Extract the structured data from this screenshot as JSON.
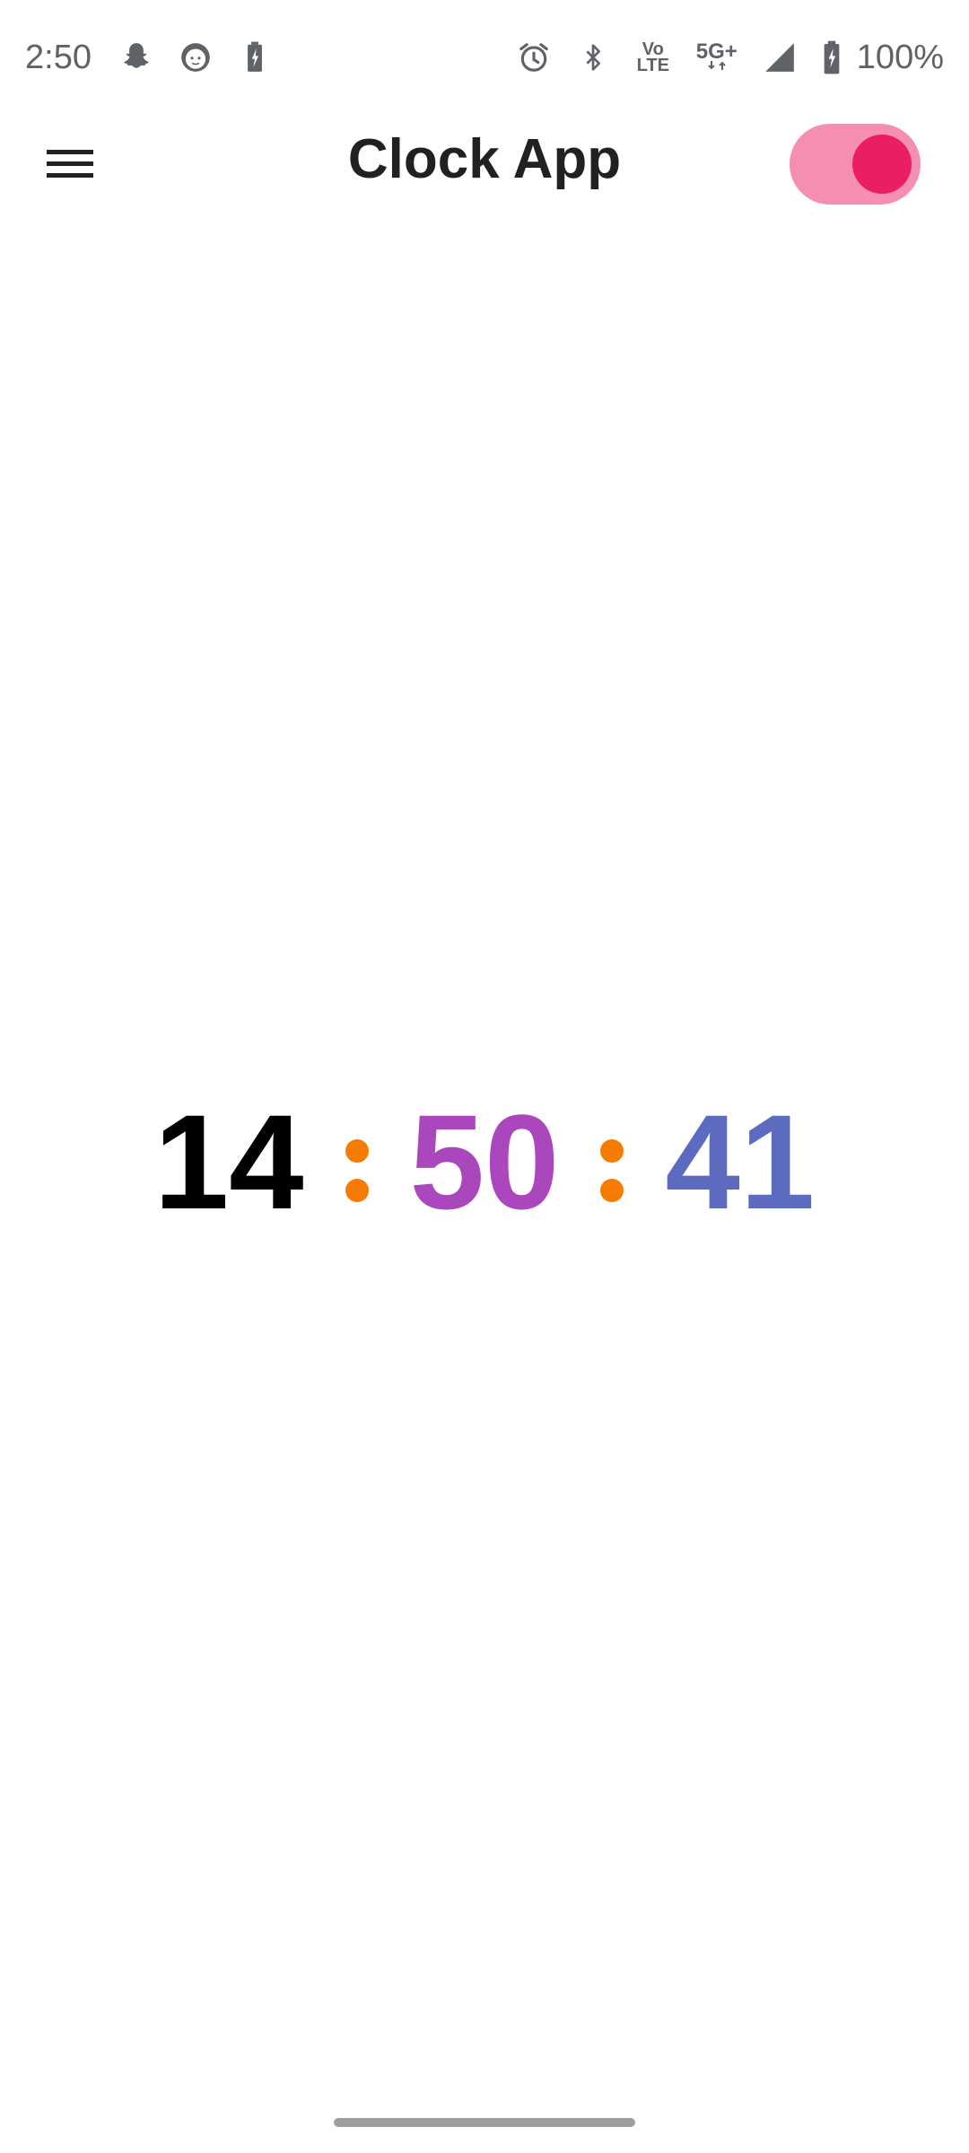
{
  "status_bar": {
    "time": "2:50",
    "volte_label_top": "Vo",
    "volte_label_bottom": "LTE",
    "network_label": "5G+",
    "battery_pct": "100%",
    "icons": [
      "snapchat-icon",
      "face-icon",
      "battery-saver-icon",
      "alarm-icon",
      "bluetooth-icon",
      "volte-icon",
      "5g-plus-icon",
      "signal-icon",
      "battery-charging-icon"
    ]
  },
  "app_bar": {
    "title": "Clock App",
    "menu_icon": "menu-icon",
    "toggle_state": "on"
  },
  "clock": {
    "hours": "14",
    "minutes": "50",
    "seconds": "41",
    "colors": {
      "hours": "#000000",
      "minutes": "#ab47bc",
      "seconds": "#5c6bc0",
      "separator": "#f57c00"
    }
  },
  "theme": {
    "toggle_track": "#f48fb1",
    "toggle_knob": "#e91e63"
  }
}
